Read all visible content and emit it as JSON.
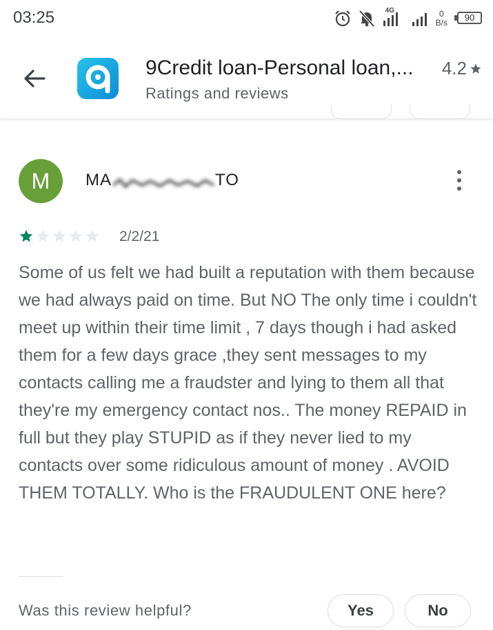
{
  "status_bar": {
    "time": "03:25",
    "network": "4G",
    "speed_value": "0",
    "speed_unit": "B/s",
    "battery": "90",
    "icons": [
      "alarm-icon",
      "mute-icon",
      "signal-icon",
      "signal-icon",
      "battery-icon"
    ]
  },
  "app": {
    "title": "9Credit loan-Personal loan,...",
    "subtitle": "Ratings and reviews",
    "rating": "4.2",
    "accent": "#1aa7e0"
  },
  "review": {
    "avatar_initial": "M",
    "avatar_color": "#689f38",
    "reviewer_prefix": "MA",
    "reviewer_suffix": "TO",
    "star_rating": 1,
    "stars_total": 5,
    "star_color": "#01875f",
    "date": "2/2/21",
    "text": "Some of us felt we had built a reputation with them because we had always paid on time. But NO The only time i couldn't meet up within their time limit , 7 days though i had asked them for a few days grace ,they sent messages to my contacts calling me a fraudster and lying to them all that they're my emergency contact nos.. The money REPAID in full but they play STUPID as if they never lied to my contacts over some ridiculous amount of money . AVOID THEM TOTALLY. Who is the FRAUDULENT ONE here?"
  },
  "helpful": {
    "question": "Was this review helpful?",
    "yes_label": "Yes",
    "no_label": "No"
  }
}
